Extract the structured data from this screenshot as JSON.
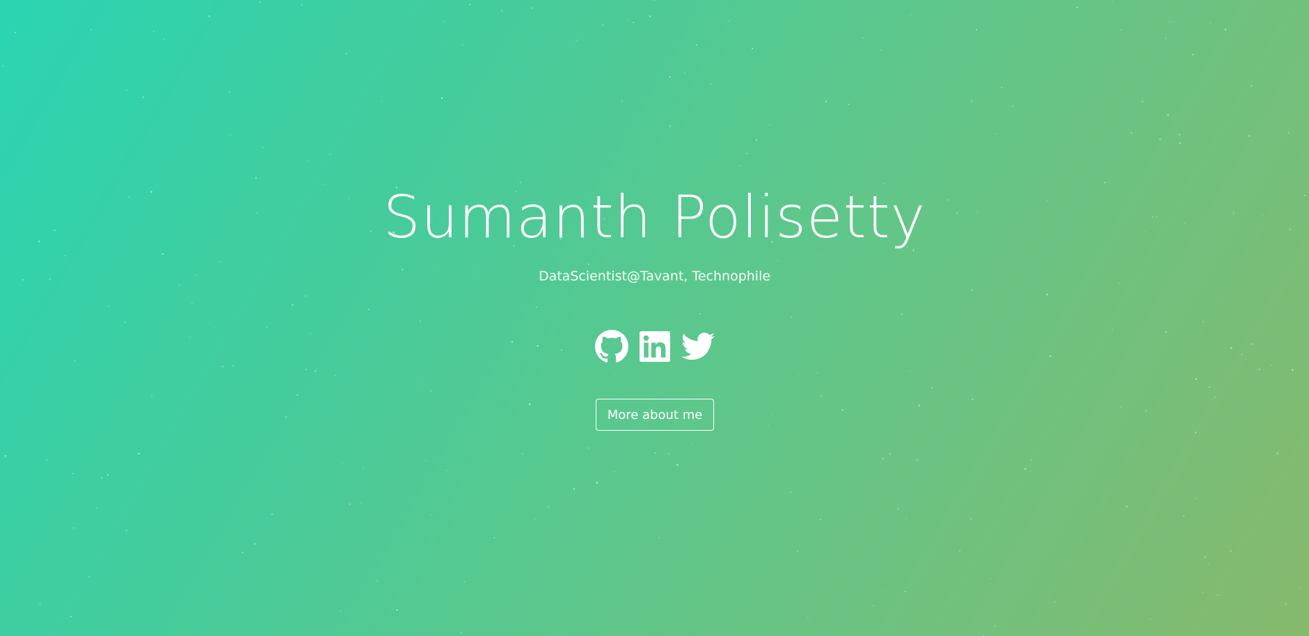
{
  "hero": {
    "name": "Sumanth Polisetty",
    "tagline": "DataScientist@Tavant, Technophile",
    "button_label": "More about me"
  },
  "socials": [
    {
      "icon": "github-icon"
    },
    {
      "icon": "linkedin-icon"
    },
    {
      "icon": "twitter-icon"
    }
  ],
  "colors": {
    "gradient_start": "#2bd4b2",
    "gradient_end": "#86b96c",
    "text": "#ffffff"
  }
}
